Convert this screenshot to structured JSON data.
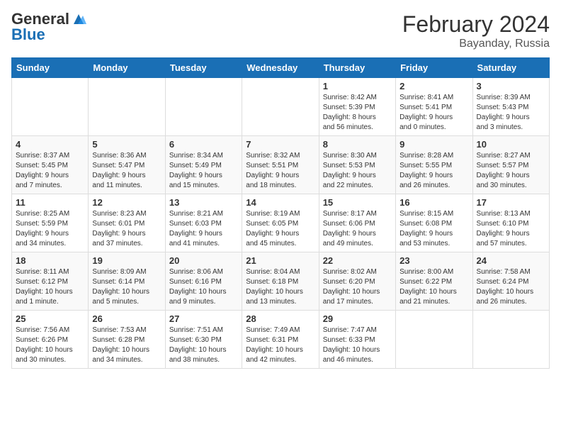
{
  "header": {
    "logo_general": "General",
    "logo_blue": "Blue",
    "title": "February 2024",
    "subtitle": "Bayanday, Russia"
  },
  "days_of_week": [
    "Sunday",
    "Monday",
    "Tuesday",
    "Wednesday",
    "Thursday",
    "Friday",
    "Saturday"
  ],
  "weeks": [
    [
      {
        "day": "",
        "info": ""
      },
      {
        "day": "",
        "info": ""
      },
      {
        "day": "",
        "info": ""
      },
      {
        "day": "",
        "info": ""
      },
      {
        "day": "1",
        "info": "Sunrise: 8:42 AM\nSunset: 5:39 PM\nDaylight: 8 hours\nand 56 minutes."
      },
      {
        "day": "2",
        "info": "Sunrise: 8:41 AM\nSunset: 5:41 PM\nDaylight: 9 hours\nand 0 minutes."
      },
      {
        "day": "3",
        "info": "Sunrise: 8:39 AM\nSunset: 5:43 PM\nDaylight: 9 hours\nand 3 minutes."
      }
    ],
    [
      {
        "day": "4",
        "info": "Sunrise: 8:37 AM\nSunset: 5:45 PM\nDaylight: 9 hours\nand 7 minutes."
      },
      {
        "day": "5",
        "info": "Sunrise: 8:36 AM\nSunset: 5:47 PM\nDaylight: 9 hours\nand 11 minutes."
      },
      {
        "day": "6",
        "info": "Sunrise: 8:34 AM\nSunset: 5:49 PM\nDaylight: 9 hours\nand 15 minutes."
      },
      {
        "day": "7",
        "info": "Sunrise: 8:32 AM\nSunset: 5:51 PM\nDaylight: 9 hours\nand 18 minutes."
      },
      {
        "day": "8",
        "info": "Sunrise: 8:30 AM\nSunset: 5:53 PM\nDaylight: 9 hours\nand 22 minutes."
      },
      {
        "day": "9",
        "info": "Sunrise: 8:28 AM\nSunset: 5:55 PM\nDaylight: 9 hours\nand 26 minutes."
      },
      {
        "day": "10",
        "info": "Sunrise: 8:27 AM\nSunset: 5:57 PM\nDaylight: 9 hours\nand 30 minutes."
      }
    ],
    [
      {
        "day": "11",
        "info": "Sunrise: 8:25 AM\nSunset: 5:59 PM\nDaylight: 9 hours\nand 34 minutes."
      },
      {
        "day": "12",
        "info": "Sunrise: 8:23 AM\nSunset: 6:01 PM\nDaylight: 9 hours\nand 37 minutes."
      },
      {
        "day": "13",
        "info": "Sunrise: 8:21 AM\nSunset: 6:03 PM\nDaylight: 9 hours\nand 41 minutes."
      },
      {
        "day": "14",
        "info": "Sunrise: 8:19 AM\nSunset: 6:05 PM\nDaylight: 9 hours\nand 45 minutes."
      },
      {
        "day": "15",
        "info": "Sunrise: 8:17 AM\nSunset: 6:06 PM\nDaylight: 9 hours\nand 49 minutes."
      },
      {
        "day": "16",
        "info": "Sunrise: 8:15 AM\nSunset: 6:08 PM\nDaylight: 9 hours\nand 53 minutes."
      },
      {
        "day": "17",
        "info": "Sunrise: 8:13 AM\nSunset: 6:10 PM\nDaylight: 9 hours\nand 57 minutes."
      }
    ],
    [
      {
        "day": "18",
        "info": "Sunrise: 8:11 AM\nSunset: 6:12 PM\nDaylight: 10 hours\nand 1 minute."
      },
      {
        "day": "19",
        "info": "Sunrise: 8:09 AM\nSunset: 6:14 PM\nDaylight: 10 hours\nand 5 minutes."
      },
      {
        "day": "20",
        "info": "Sunrise: 8:06 AM\nSunset: 6:16 PM\nDaylight: 10 hours\nand 9 minutes."
      },
      {
        "day": "21",
        "info": "Sunrise: 8:04 AM\nSunset: 6:18 PM\nDaylight: 10 hours\nand 13 minutes."
      },
      {
        "day": "22",
        "info": "Sunrise: 8:02 AM\nSunset: 6:20 PM\nDaylight: 10 hours\nand 17 minutes."
      },
      {
        "day": "23",
        "info": "Sunrise: 8:00 AM\nSunset: 6:22 PM\nDaylight: 10 hours\nand 21 minutes."
      },
      {
        "day": "24",
        "info": "Sunrise: 7:58 AM\nSunset: 6:24 PM\nDaylight: 10 hours\nand 26 minutes."
      }
    ],
    [
      {
        "day": "25",
        "info": "Sunrise: 7:56 AM\nSunset: 6:26 PM\nDaylight: 10 hours\nand 30 minutes."
      },
      {
        "day": "26",
        "info": "Sunrise: 7:53 AM\nSunset: 6:28 PM\nDaylight: 10 hours\nand 34 minutes."
      },
      {
        "day": "27",
        "info": "Sunrise: 7:51 AM\nSunset: 6:30 PM\nDaylight: 10 hours\nand 38 minutes."
      },
      {
        "day": "28",
        "info": "Sunrise: 7:49 AM\nSunset: 6:31 PM\nDaylight: 10 hours\nand 42 minutes."
      },
      {
        "day": "29",
        "info": "Sunrise: 7:47 AM\nSunset: 6:33 PM\nDaylight: 10 hours\nand 46 minutes."
      },
      {
        "day": "",
        "info": ""
      },
      {
        "day": "",
        "info": ""
      }
    ]
  ]
}
